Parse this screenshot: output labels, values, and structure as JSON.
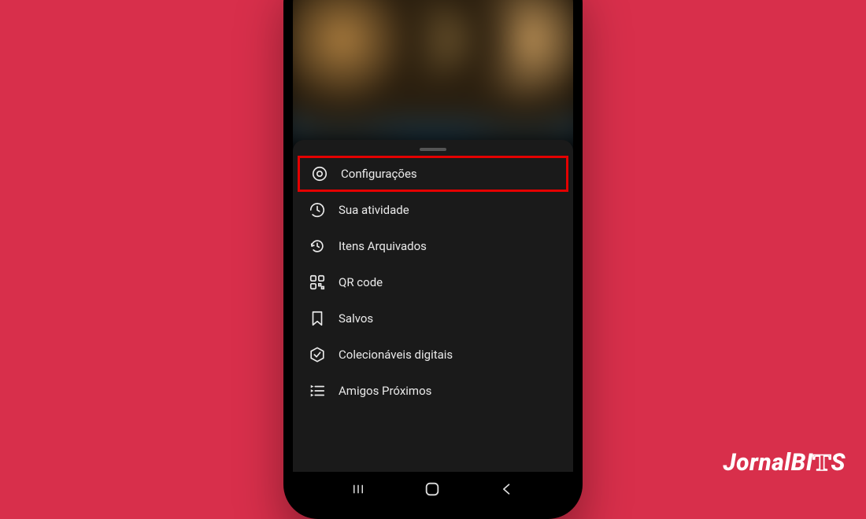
{
  "watermark": {
    "part1": "Jornal",
    "part2": "BI",
    "part3": "T",
    "part4": "S"
  },
  "sheet": {
    "items": [
      {
        "label": "Configurações",
        "icon": "settings",
        "highlighted": true
      },
      {
        "label": "Sua atividade",
        "icon": "activity",
        "highlighted": false
      },
      {
        "label": "Itens Arquivados",
        "icon": "archive",
        "highlighted": false
      },
      {
        "label": "QR code",
        "icon": "qr",
        "highlighted": false
      },
      {
        "label": "Salvos",
        "icon": "saved",
        "highlighted": false
      },
      {
        "label": "Colecionáveis digitais",
        "icon": "collectibles",
        "highlighted": false
      },
      {
        "label": "Amigos Próximos",
        "icon": "closefriends",
        "highlighted": false
      }
    ]
  }
}
